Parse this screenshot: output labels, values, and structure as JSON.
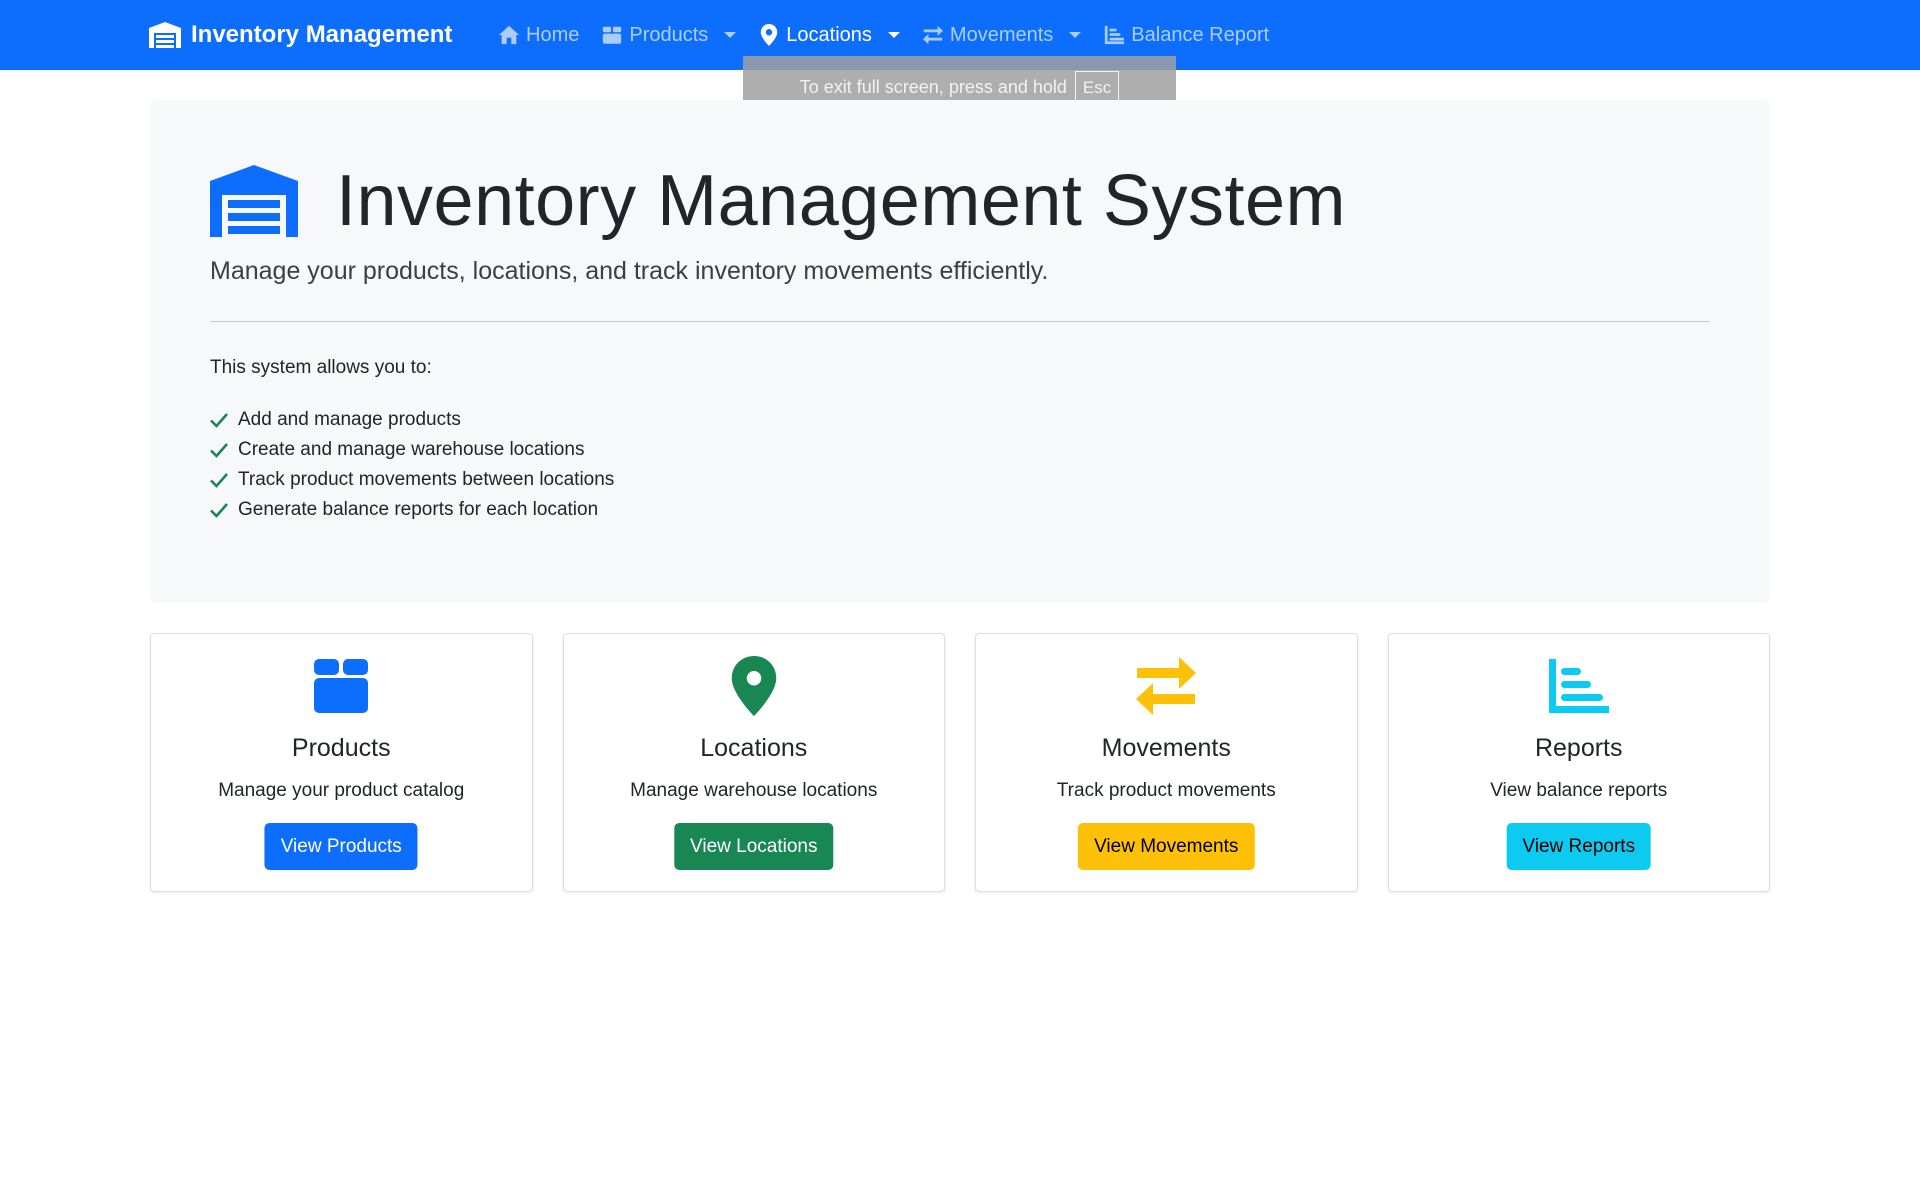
{
  "navbar": {
    "brand": "Inventory Management",
    "items": [
      {
        "label": "Home",
        "icon": "home-icon",
        "dropdown": false,
        "active": false
      },
      {
        "label": "Products",
        "icon": "box-icon",
        "dropdown": true,
        "active": false
      },
      {
        "label": "Locations",
        "icon": "map-pin-icon",
        "dropdown": true,
        "active": true
      },
      {
        "label": "Movements",
        "icon": "exchange-arrows-icon",
        "dropdown": true,
        "active": false
      },
      {
        "label": "Balance Report",
        "icon": "bar-chart-icon",
        "dropdown": false,
        "active": false
      }
    ]
  },
  "fullscreen_notice": {
    "text": "To exit full screen, press and hold",
    "key": "Esc"
  },
  "hero": {
    "title": "Inventory Management System",
    "lead": "Manage your products, locations, and track inventory movements efficiently.",
    "intro": "This system allows you to:",
    "features": [
      "Add and manage products",
      "Create and manage warehouse locations",
      "Track product movements between locations",
      "Generate balance reports for each location"
    ]
  },
  "cards": [
    {
      "title": "Products",
      "description": "Manage your product catalog",
      "button": "View Products",
      "icon": "box-icon",
      "color": "#0d6efd",
      "button_text_color": "#ffffff"
    },
    {
      "title": "Locations",
      "description": "Manage warehouse locations",
      "button": "View Locations",
      "icon": "map-pin-icon",
      "color": "#198754",
      "button_text_color": "#ffffff"
    },
    {
      "title": "Movements",
      "description": "Track product movements",
      "button": "View Movements",
      "icon": "exchange-arrows-icon",
      "color": "#ffc107",
      "button_text_color": "#000000"
    },
    {
      "title": "Reports",
      "description": "View balance reports",
      "button": "View Reports",
      "icon": "bar-chart-icon",
      "color": "#0dcaf0",
      "button_text_color": "#000000"
    }
  ],
  "colors": {
    "primary": "#0d6efd",
    "success": "#198754",
    "warning": "#ffc107",
    "info": "#0dcaf0"
  }
}
